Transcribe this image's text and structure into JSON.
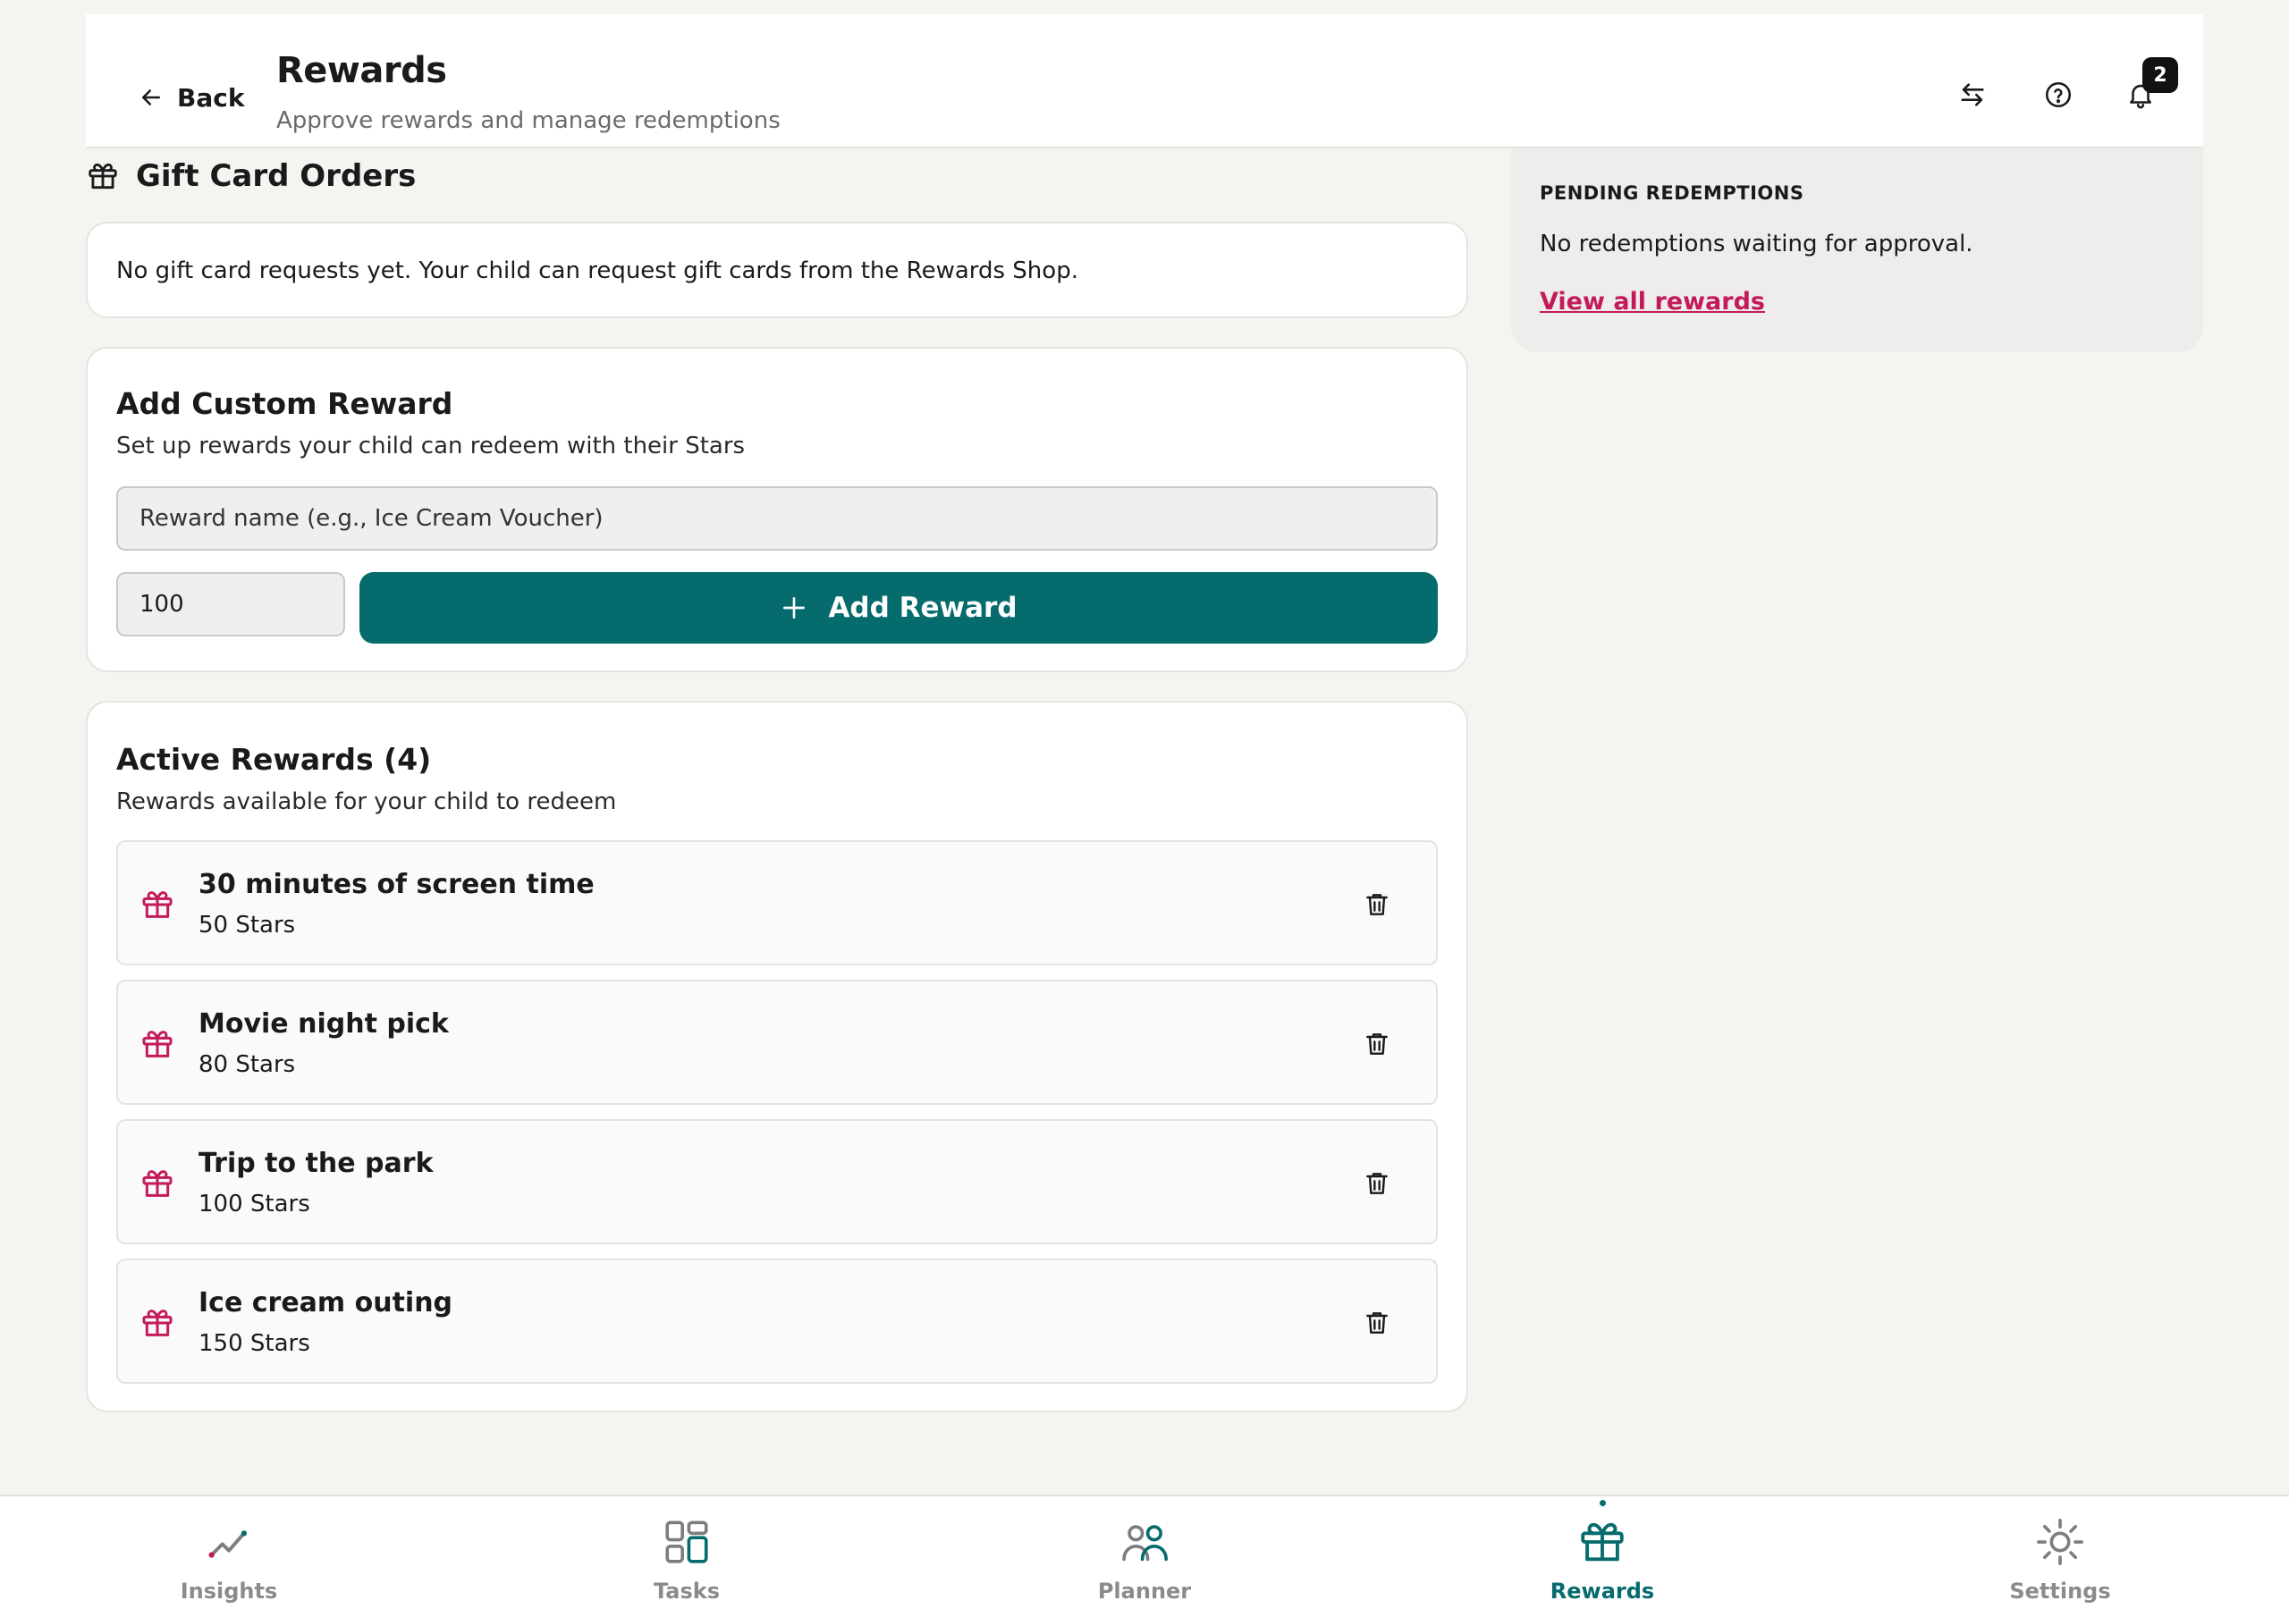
{
  "header": {
    "back_label": "Back",
    "title": "Rewards",
    "subtitle": "Approve rewards and manage redemptions",
    "notification_count": "2",
    "icons": [
      "swap-icon",
      "help-icon",
      "bell-icon"
    ]
  },
  "gift_cards": {
    "heading": "Gift Card Orders",
    "empty_message": "No gift card requests yet. Your child can request gift cards from the Rewards Shop."
  },
  "add_reward": {
    "title": "Add Custom Reward",
    "subtitle": "Set up rewards your child can redeem with their Stars",
    "name_placeholder": "Reward name (e.g., Ice Cream Voucher)",
    "stars_value": "100",
    "button_label": "Add Reward"
  },
  "active_rewards": {
    "title": "Active Rewards (4)",
    "subtitle": "Rewards available for your child to redeem",
    "items": [
      {
        "name": "30 minutes of screen time",
        "stars": "50 Stars"
      },
      {
        "name": "Movie night pick",
        "stars": "80 Stars"
      },
      {
        "name": "Trip to the park",
        "stars": "100 Stars"
      },
      {
        "name": "Ice cream outing",
        "stars": "150 Stars"
      }
    ]
  },
  "pending": {
    "title": "PENDING REDEMPTIONS",
    "message": "No redemptions waiting for approval.",
    "link": "View all rewards"
  },
  "nav": {
    "items": [
      {
        "label": "Insights",
        "icon": "insights-icon"
      },
      {
        "label": "Tasks",
        "icon": "tasks-icon"
      },
      {
        "label": "Planner",
        "icon": "planner-icon"
      },
      {
        "label": "Rewards",
        "icon": "rewards-icon",
        "active": true
      },
      {
        "label": "Settings",
        "icon": "settings-icon"
      }
    ]
  },
  "colors": {
    "accent": "#066b6c",
    "gift_pink": "#c41a5b",
    "background": "#f5f4f1"
  }
}
